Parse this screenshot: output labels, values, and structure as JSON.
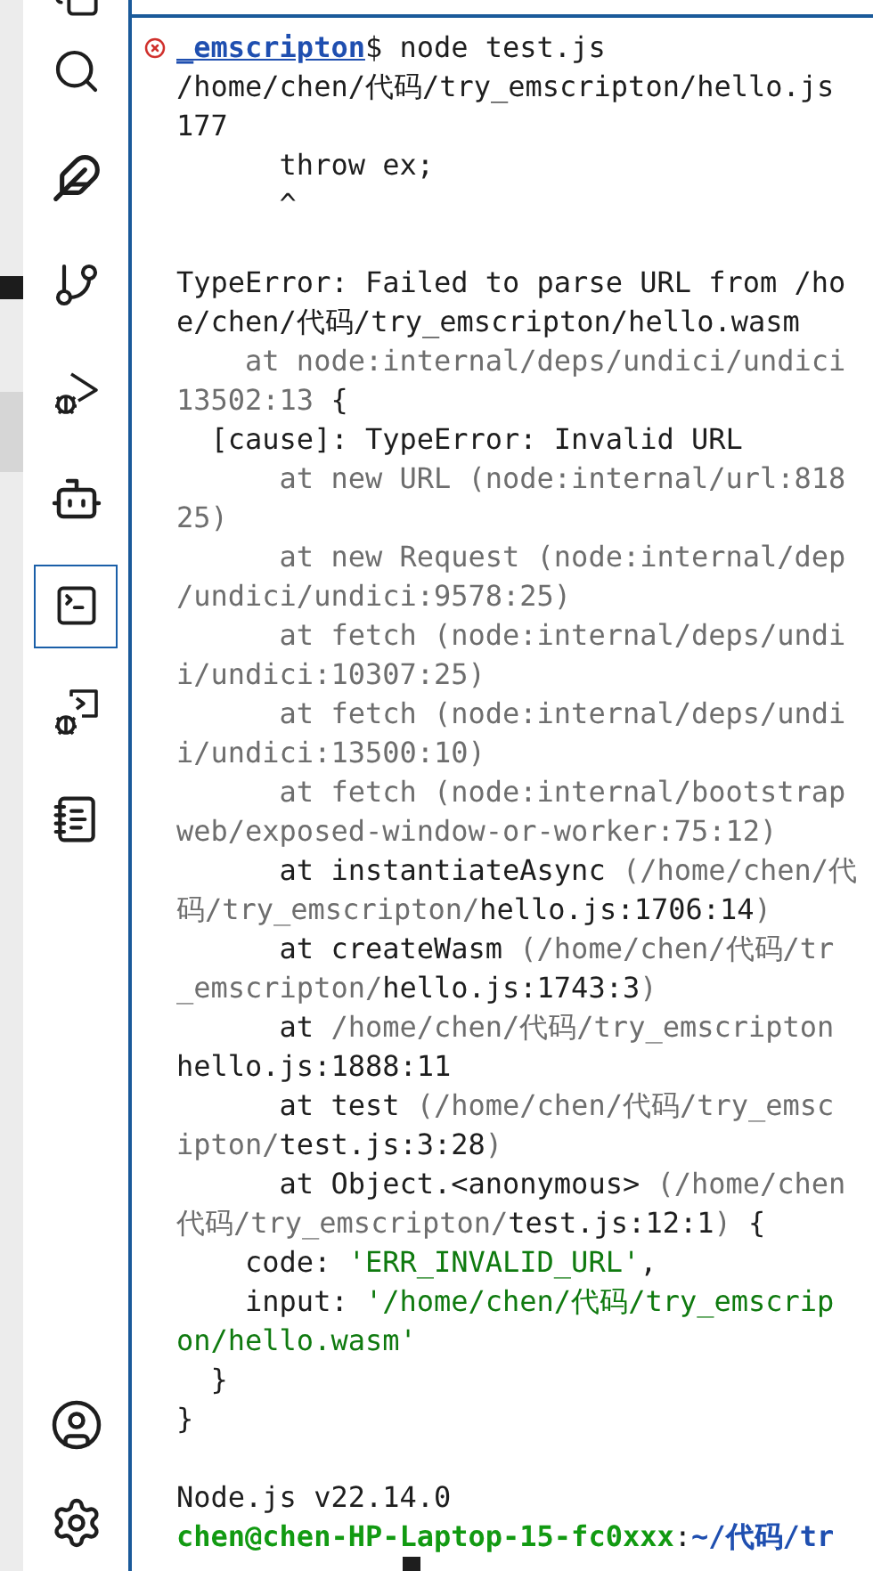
{
  "activity_bar": {
    "items": [
      {
        "selected": false
      },
      {
        "selected": false
      },
      {
        "selected": false
      },
      {
        "selected": false
      },
      {
        "selected": false
      },
      {
        "selected": false
      },
      {
        "selected": true
      },
      {
        "selected": false
      },
      {
        "selected": false
      }
    ],
    "bottom_items": [
      {
        "selected": false
      },
      {
        "selected": false
      }
    ]
  },
  "terminal": {
    "cursor": true,
    "command": {
      "failed": true,
      "segments": [
        {
          "kind": "path",
          "text": "_emscripton"
        },
        {
          "kind": "normal",
          "text": "$ node test.js"
        }
      ]
    },
    "blocks": [
      {
        "lines": [
          {
            "segments": [
              {
                "kind": "normal",
                "text": "/home/chen/代码/try_emscripton/hello.js"
              }
            ]
          },
          {
            "segments": [
              {
                "kind": "normal",
                "text": "177"
              }
            ]
          },
          {
            "segments": [
              {
                "kind": "normal",
                "text": "      throw ex;"
              }
            ]
          },
          {
            "segments": [
              {
                "kind": "normal",
                "text": "      ^"
              }
            ]
          }
        ]
      },
      {
        "lines": [
          {
            "segments": [
              {
                "kind": "normal",
                "text": "TypeError: Failed to parse URL from /ho"
              }
            ]
          },
          {
            "segments": [
              {
                "kind": "normal",
                "text": "e/chen/代码/try_emscripton/hello.wasm"
              }
            ]
          },
          {
            "segments": [
              {
                "kind": "dim",
                "text": "    at node:internal/deps/undici/undici"
              }
            ]
          },
          {
            "segments": [
              {
                "kind": "dim",
                "text": "13502:13"
              },
              {
                "kind": "normal",
                "text": " {"
              }
            ]
          },
          {
            "segments": [
              {
                "kind": "normal",
                "text": "  [cause]: TypeError: Invalid URL"
              }
            ]
          },
          {
            "segments": [
              {
                "kind": "dim",
                "text": "      at new URL (node:internal/url:818"
              }
            ]
          },
          {
            "segments": [
              {
                "kind": "dim",
                "text": "25)"
              }
            ]
          },
          {
            "segments": [
              {
                "kind": "dim",
                "text": "      at new Request (node:internal/dep"
              }
            ]
          },
          {
            "segments": [
              {
                "kind": "dim",
                "text": "/undici/undici:9578:25)"
              }
            ]
          },
          {
            "segments": [
              {
                "kind": "dim",
                "text": "      at fetch (node:internal/deps/undi"
              }
            ]
          },
          {
            "segments": [
              {
                "kind": "dim",
                "text": "i/undici:10307:25)"
              }
            ]
          },
          {
            "segments": [
              {
                "kind": "dim",
                "text": "      at fetch (node:internal/deps/undi"
              }
            ]
          },
          {
            "segments": [
              {
                "kind": "dim",
                "text": "i/undici:13500:10)"
              }
            ]
          },
          {
            "segments": [
              {
                "kind": "dim",
                "text": "      at fetch (node:internal/bootstrap"
              }
            ]
          },
          {
            "segments": [
              {
                "kind": "dim",
                "text": "web/exposed-window-or-worker:75:12)"
              }
            ]
          },
          {
            "segments": [
              {
                "kind": "normal",
                "text": "      at instantiateAsync "
              },
              {
                "kind": "dim",
                "text": "(/home/chen/代"
              }
            ]
          },
          {
            "segments": [
              {
                "kind": "dim",
                "text": "码/try_emscripton/"
              },
              {
                "kind": "normal",
                "text": "hello.js:1706:14"
              },
              {
                "kind": "dim",
                "text": ")"
              }
            ]
          },
          {
            "segments": [
              {
                "kind": "normal",
                "text": "      at createWasm "
              },
              {
                "kind": "dim",
                "text": "(/home/chen/代码/tr"
              }
            ]
          },
          {
            "segments": [
              {
                "kind": "dim",
                "text": "_emscripton/"
              },
              {
                "kind": "normal",
                "text": "hello.js:1743:3"
              },
              {
                "kind": "dim",
                "text": ")"
              }
            ]
          },
          {
            "segments": [
              {
                "kind": "normal",
                "text": "      at "
              },
              {
                "kind": "dim",
                "text": "/home/chen/代码/try_emscripton"
              }
            ]
          },
          {
            "segments": [
              {
                "kind": "normal",
                "text": "hello.js:1888:11"
              }
            ]
          },
          {
            "segments": [
              {
                "kind": "normal",
                "text": "      at test "
              },
              {
                "kind": "dim",
                "text": "(/home/chen/代码/try_emsc"
              }
            ]
          },
          {
            "segments": [
              {
                "kind": "dim",
                "text": "ipton/"
              },
              {
                "kind": "normal",
                "text": "test.js:3:28"
              },
              {
                "kind": "dim",
                "text": ")"
              }
            ]
          },
          {
            "segments": [
              {
                "kind": "normal",
                "text": "      at Object.<anonymous> "
              },
              {
                "kind": "dim",
                "text": "(/home/chen"
              }
            ]
          },
          {
            "segments": [
              {
                "kind": "dim",
                "text": "代码/try_emscripton/"
              },
              {
                "kind": "normal",
                "text": "test.js:12:1"
              },
              {
                "kind": "dim",
                "text": ")"
              },
              {
                "kind": "normal",
                "text": " {"
              }
            ]
          },
          {
            "segments": [
              {
                "kind": "normal",
                "text": "    code: "
              },
              {
                "kind": "string",
                "text": "'ERR_INVALID_URL'"
              },
              {
                "kind": "normal",
                "text": ","
              }
            ]
          },
          {
            "segments": [
              {
                "kind": "normal",
                "text": "    input: "
              },
              {
                "kind": "string",
                "text": "'/home/chen/代码/try_emscrip"
              }
            ]
          },
          {
            "segments": [
              {
                "kind": "string",
                "text": "on/hello.wasm'"
              }
            ]
          },
          {
            "segments": [
              {
                "kind": "normal",
                "text": "  }"
              }
            ]
          },
          {
            "segments": [
              {
                "kind": "normal",
                "text": "}"
              }
            ]
          }
        ]
      },
      {
        "lines": [
          {
            "segments": [
              {
                "kind": "normal",
                "text": "Node.js v22.14.0"
              }
            ]
          },
          {
            "segments": [
              {
                "kind": "user",
                "text": "chen@chen-HP-Laptop-15-fc0xxx"
              },
              {
                "kind": "normal",
                "text": ":"
              },
              {
                "kind": "path",
                "text": "~/代码/tr"
              }
            ]
          }
        ]
      }
    ]
  }
}
